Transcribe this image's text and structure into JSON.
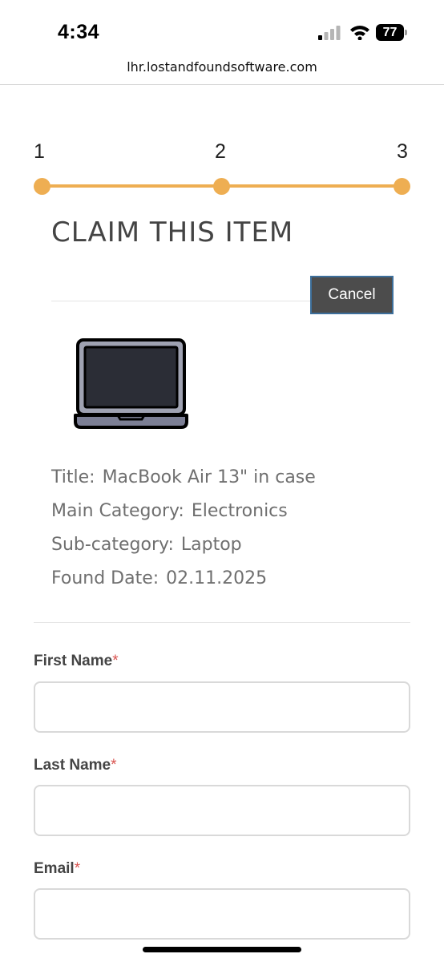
{
  "status_bar": {
    "time": "4:34",
    "battery": "77",
    "signal_icon": "cellular-signal-icon",
    "wifi_icon": "wifi-icon"
  },
  "browser": {
    "url": "lhr.lostandfoundsoftware.com"
  },
  "stepper": {
    "steps": [
      "1",
      "2",
      "3"
    ],
    "accent_color": "#eeae52"
  },
  "claim": {
    "title": "CLAIM THIS ITEM",
    "cancel_label": "Cancel",
    "item_icon": "laptop-icon",
    "details": [
      {
        "label": "Title:",
        "value": "MacBook Air 13\" in case"
      },
      {
        "label": "Main Category:",
        "value": "Electronics"
      },
      {
        "label": "Sub-category:",
        "value": "Laptop"
      },
      {
        "label": "Found Date:",
        "value": "02.11.2025"
      }
    ]
  },
  "form": {
    "required_mark": "*",
    "fields": [
      {
        "label": "First Name",
        "value": ""
      },
      {
        "label": "Last Name",
        "value": ""
      },
      {
        "label": "Email",
        "value": ""
      }
    ]
  }
}
